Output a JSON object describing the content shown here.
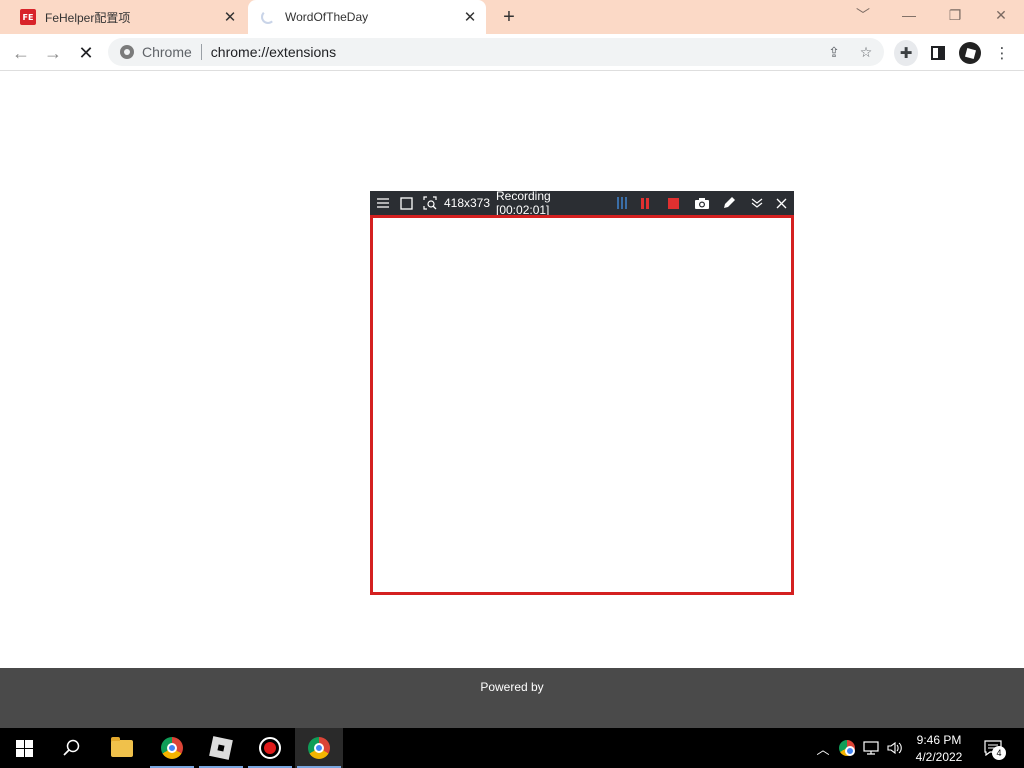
{
  "browser": {
    "tabs": [
      {
        "title": "FeHelper配置项",
        "favicon": "fehelper-logo",
        "favicon_text": "FE",
        "active": false
      },
      {
        "title": "WordOfTheDay",
        "favicon": "loading-spinner",
        "active": true
      }
    ],
    "new_tab_icon": "+",
    "window_controls": {
      "tab_search": "﹀",
      "minimize": "—",
      "restore": "❐",
      "close": "✕"
    },
    "address_bar": {
      "scheme_label": "Chrome",
      "url": "chrome://extensions"
    },
    "nav": {
      "back": "←",
      "forward": "→",
      "stop": "✕"
    },
    "toolbar_icons": [
      "share-icon",
      "bookmark-star-icon",
      "extensions-puzzle-icon",
      "side-panel-icon",
      "profile-avatar",
      "menu-kebab-icon"
    ]
  },
  "recorder": {
    "dimensions": "418x373",
    "status": "Recording [00:02:01]",
    "frame_color": "#d42020",
    "controls": [
      "menu-icon",
      "select-region-icon",
      "zoom-region-icon",
      "pause-icon",
      "stop-icon",
      "camera-icon",
      "pen-icon",
      "collapse-icon",
      "close-icon"
    ]
  },
  "footer": {
    "text": "Powered by"
  },
  "taskbar": {
    "clock_time": "9:46 PM",
    "clock_date": "4/2/2022",
    "notification_count": "4",
    "apps": [
      "windows-start",
      "search",
      "file-explorer",
      "chrome-profile",
      "roblox",
      "screen-recorder",
      "chrome"
    ]
  }
}
